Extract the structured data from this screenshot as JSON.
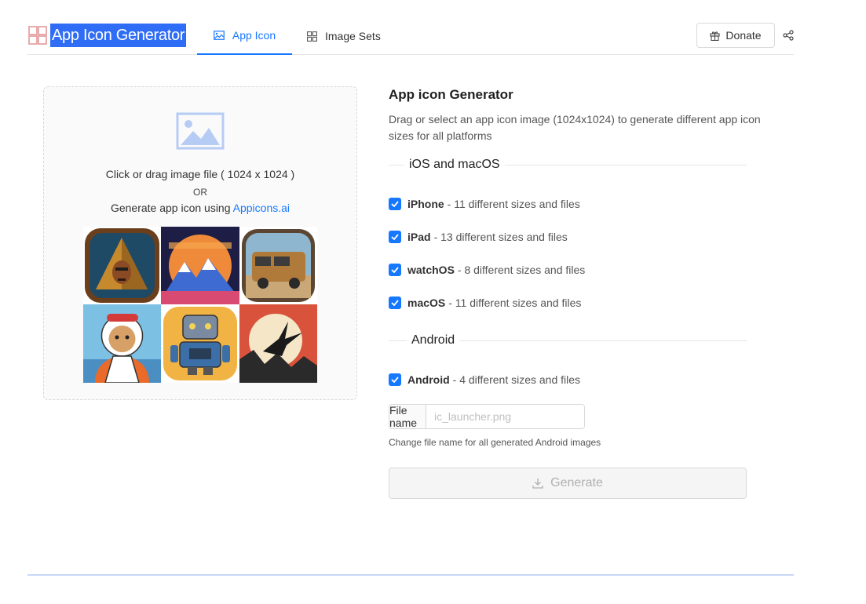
{
  "header": {
    "logo_text": "App Icon Generator",
    "logo_icon": "grid-logo-icon",
    "tabs": [
      {
        "label": "App Icon",
        "icon": "image-icon",
        "active": true
      },
      {
        "label": "Image Sets",
        "icon": "grid-icon",
        "active": false
      }
    ],
    "donate_label": "Donate",
    "donate_icon": "gift-icon",
    "share_icon": "share-icon"
  },
  "dropzone": {
    "icon": "image-icon",
    "hint": "Click or drag image file ( 1024 x 1024 )",
    "or": "OR",
    "generate_prefix": "Generate app icon using",
    "generate_link": "Appicons.ai"
  },
  "panel": {
    "title": "App icon Generator",
    "description": "Drag or select an app icon image (1024x1024) to generate different app icon sizes for all platforms",
    "sections": [
      {
        "heading": "iOS and macOS",
        "items": [
          {
            "name": "iPhone",
            "detail": "- 11 different sizes and files",
            "checked": true
          },
          {
            "name": "iPad",
            "detail": "- 13 different sizes and files",
            "checked": true
          },
          {
            "name": "watchOS",
            "detail": "- 8 different sizes and files",
            "checked": true
          },
          {
            "name": "macOS",
            "detail": "- 11 different sizes and files",
            "checked": true
          }
        ]
      },
      {
        "heading": "Android",
        "items": [
          {
            "name": "Android",
            "detail": "- 4 different sizes and files",
            "checked": true
          }
        ]
      }
    ],
    "file_name_label": "File name",
    "file_name_value": "",
    "file_name_placeholder": "ic_launcher.png",
    "file_name_help": "Change file name for all generated Android images",
    "generate_label": "Generate",
    "generate_icon": "download-icon"
  },
  "colors": {
    "accent": "#1677ff",
    "logo_highlight": "#2f6df6",
    "disabled_text": "#b0b0b0"
  }
}
